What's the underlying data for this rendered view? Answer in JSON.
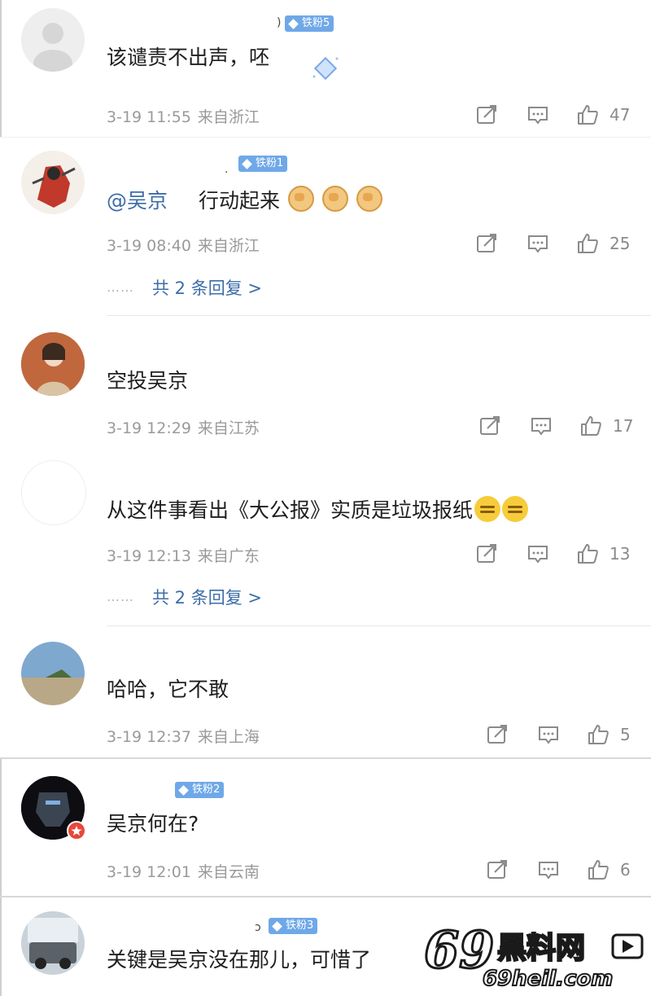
{
  "badge_color": "#6fa8e8",
  "link_color": "#3d6da8",
  "comments": [
    {
      "name_fragment": ")",
      "badge": "铁粉5",
      "text": "该谴责不出声，呸",
      "date": "3-19 11:55",
      "location": "来自浙江",
      "likes": "47"
    },
    {
      "name_fragment": ".",
      "badge": "铁粉1",
      "mention": "@吴京",
      "text": "行动起来",
      "emoji": "fist-icon x3",
      "date": "3-19 08:40",
      "location": "来自浙江",
      "likes": "25",
      "replies": "共 2 条回复 >"
    },
    {
      "text": "空投吴京",
      "date": "3-19 12:29",
      "location": "来自江苏",
      "likes": "17"
    },
    {
      "text": "从这件事看出《大公报》实质是垃圾报纸",
      "emoji": "smirk-icon x2",
      "date": "3-19 12:13",
      "location": "来自广东",
      "likes": "13",
      "replies": "共 2 条回复 >"
    },
    {
      "text": "哈哈，它不敢",
      "date": "3-19 12:37",
      "location": "来自上海",
      "likes": "5"
    },
    {
      "badge": "铁粉2",
      "text": "吴京何在?",
      "date": "3-19 12:01",
      "location": "来自云南",
      "likes": "6"
    },
    {
      "name_fragment": "ɔ",
      "badge": "铁粉3",
      "text": "关键是吴京没在那儿，可惜了"
    }
  ],
  "reply_dots": "……",
  "watermark": {
    "brand": "69黑料网",
    "url": "69heil.com"
  }
}
